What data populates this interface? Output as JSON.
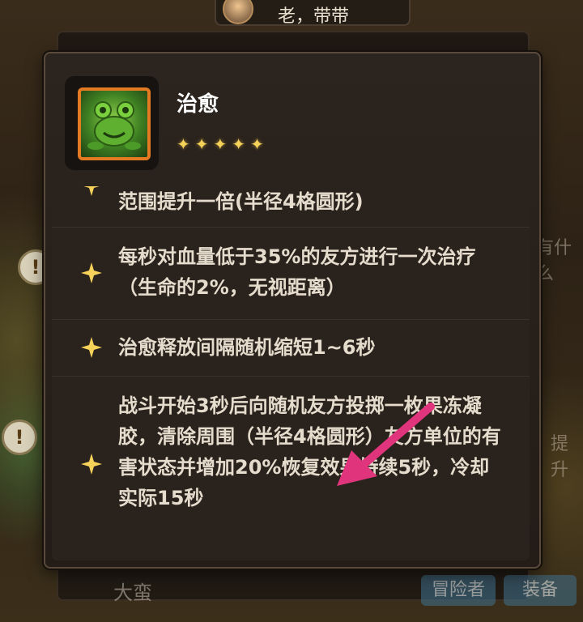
{
  "background": {
    "player_name": "老，带带",
    "right_text_1": "有什么",
    "right_text_2": "提升",
    "button_left": "冒险者",
    "button_right": "装备",
    "bottom_label": "大蛮"
  },
  "tooltip": {
    "title": "治愈",
    "star_count": 5,
    "icon": "slime-frog-skill-icon",
    "rows": [
      {
        "text": "范围提升一倍(半径4格圆形)"
      },
      {
        "text": "每秒对血量低于35%的友方进行一次治疗（生命的2%，无视距离）"
      },
      {
        "text": "治愈释放间隔随机缩短1~6秒"
      },
      {
        "text": "战斗开始3秒后向随机友方投掷一枚果冻凝胶，清除周围（半径4格圆形）友方单位的有害状态并增加20%恢复效果持续5秒，冷却实际15秒"
      }
    ]
  },
  "colors": {
    "accent_orange": "#e47a22",
    "star_gold": "#f6d25a",
    "arrow_pink": "#e0357d"
  }
}
